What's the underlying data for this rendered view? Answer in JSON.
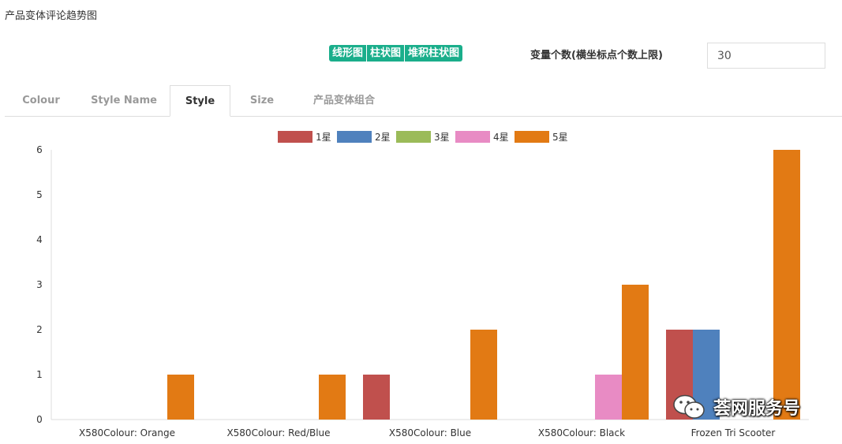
{
  "page": {
    "title": "产品变体评论趋势图"
  },
  "chart_switch": {
    "labels": [
      "线形图",
      "柱状图",
      "堆积柱状图"
    ]
  },
  "variable_count": {
    "label": "变量个数(横坐标点个数上限)",
    "value": "30"
  },
  "tabs": [
    {
      "label": "Colour"
    },
    {
      "label": "Style Name"
    },
    {
      "label": "Style"
    },
    {
      "label": "Size"
    },
    {
      "label": "产品变体组合"
    }
  ],
  "watermark": {
    "text": "荟网服务号"
  },
  "colors": {
    "accent": "#1aae8b"
  },
  "chart_data": {
    "type": "bar",
    "categories": [
      "X580Colour: Orange",
      "X580Colour: Red/Blue",
      "X580Colour: Blue",
      "X580Colour: Black",
      "Frozen Tri Scooter"
    ],
    "series": [
      {
        "name": "1星",
        "color": "#c0504d",
        "values": [
          0,
          0,
          1,
          0,
          2
        ]
      },
      {
        "name": "2星",
        "color": "#4f81bd",
        "values": [
          0,
          0,
          0,
          0,
          2
        ]
      },
      {
        "name": "3星",
        "color": "#9bbb59",
        "values": [
          0,
          0,
          0,
          0,
          0
        ]
      },
      {
        "name": "4星",
        "color": "#e88bc4",
        "values": [
          0,
          0,
          0,
          1,
          0
        ]
      },
      {
        "name": "5星",
        "color": "#e27a14",
        "values": [
          1,
          1,
          2,
          3,
          6
        ]
      }
    ],
    "ylim": [
      0,
      6
    ],
    "yticks": [
      "0",
      "1",
      "2",
      "3",
      "4",
      "5",
      "6"
    ],
    "legend_position": "top-center",
    "grid": false
  }
}
